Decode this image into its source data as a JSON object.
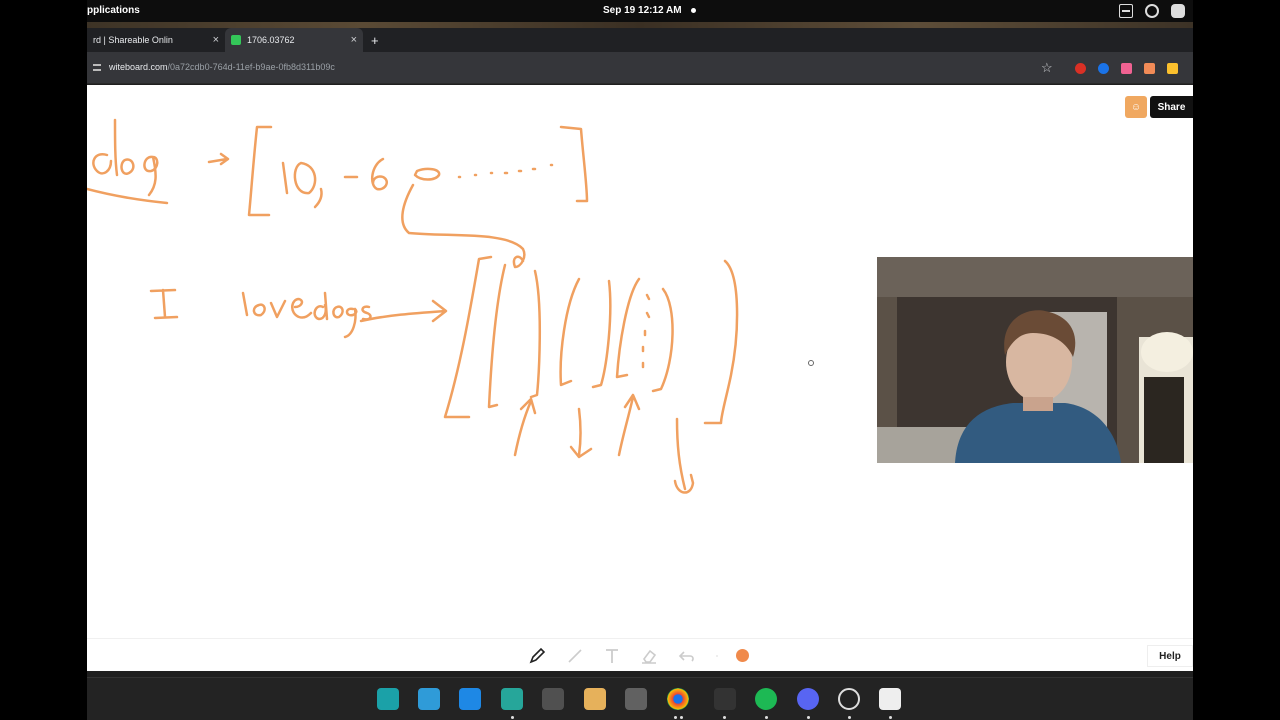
{
  "topbar": {
    "apps_label": "pplications",
    "clock": "Sep 19  12:12 AM"
  },
  "tabs": [
    {
      "label": "rd | Shareable Onlin",
      "close": "×"
    },
    {
      "label": "1706.03762",
      "close": "×"
    }
  ],
  "new_tab": "+",
  "address": {
    "url_host": "witeboard.com",
    "url_path": "/0a72cdb0-764d-11ef-b9ae-0fb8d311b09c",
    "star": "☆"
  },
  "board": {
    "share_label": "Share",
    "help_label": "Help",
    "stroke_color": "#f0a060",
    "active_color": "#f08a4b"
  },
  "icons": [
    "sidebar-icon",
    "tray-grid-icon",
    "network-icon",
    "gamepad-icon",
    "pen-icon",
    "line-icon",
    "text-icon",
    "eraser-icon",
    "undo-icon",
    "color-dot-icon"
  ]
}
